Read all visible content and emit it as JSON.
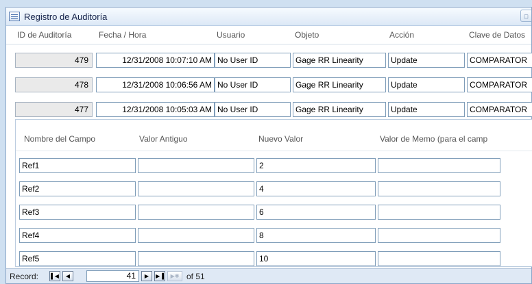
{
  "window": {
    "title": "Registro de Auditoría",
    "title_button": "□"
  },
  "columns": [
    "ID de Auditoría",
    "Fecha / Hora",
    "Usuario",
    "Objeto",
    "Acción",
    "Clave de Datos"
  ],
  "rows": [
    {
      "id": "479",
      "datetime": "12/31/2008 10:07:10 AM",
      "user": "No User ID",
      "object": "Gage RR Linearity",
      "action": "Update",
      "key": "COMPARATOR"
    },
    {
      "id": "478",
      "datetime": "12/31/2008 10:06:56 AM",
      "user": "No User ID",
      "object": "Gage RR Linearity",
      "action": "Update",
      "key": "COMPARATOR"
    },
    {
      "id": "477",
      "datetime": "12/31/2008 10:05:03 AM",
      "user": "No User ID",
      "object": "Gage RR Linearity",
      "action": "Update",
      "key": "COMPARATOR"
    }
  ],
  "subform": {
    "columns": [
      "Nombre del Campo",
      "Valor Antiguo",
      "Nuevo Valor",
      "Valor de Memo (para el camp"
    ],
    "rows": [
      {
        "field": "Ref1",
        "old": "",
        "new": "2",
        "memo": ""
      },
      {
        "field": "Ref2",
        "old": "",
        "new": "4",
        "memo": ""
      },
      {
        "field": "Ref3",
        "old": "",
        "new": "6",
        "memo": ""
      },
      {
        "field": "Ref4",
        "old": "",
        "new": "8",
        "memo": ""
      },
      {
        "field": "Ref5",
        "old": "",
        "new": "10",
        "memo": ""
      }
    ]
  },
  "navigation": {
    "label": "Record:",
    "current": "41",
    "of_text": "of 51",
    "icons": [
      "first-record-icon",
      "previous-record-icon",
      "next-record-icon",
      "last-record-icon",
      "new-record-icon"
    ]
  }
}
